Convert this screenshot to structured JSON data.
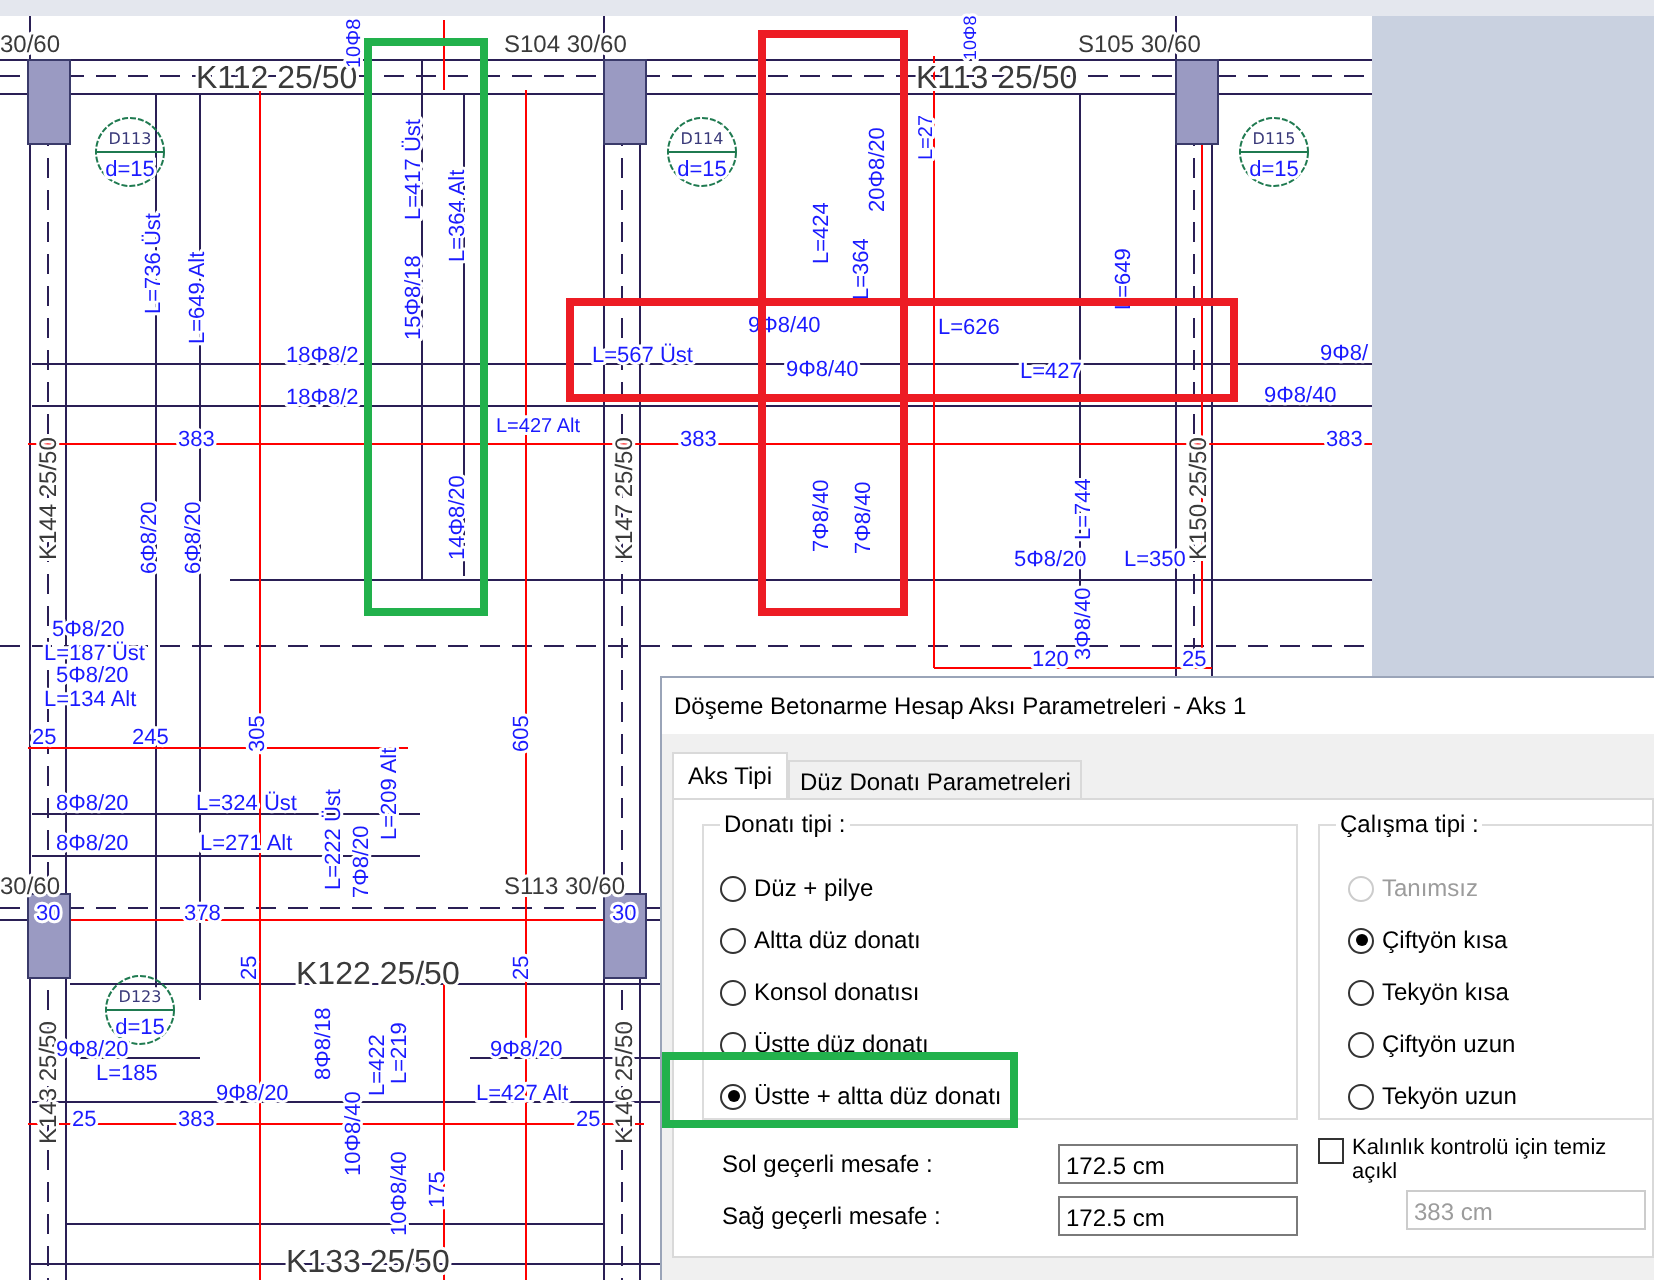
{
  "drawing": {
    "labels": [
      {
        "text": "30/60",
        "kind": "beam"
      },
      {
        "text": "S104 30/60",
        "kind": "beam"
      },
      {
        "text": "S105 30/60",
        "kind": "beam"
      },
      {
        "text": "K112 25/50",
        "kind": "beam"
      },
      {
        "text": "K113 25/50",
        "kind": "beam"
      },
      {
        "text": "L=736 Üst",
        "kind": "rebar"
      },
      {
        "text": "L=649 Alt",
        "kind": "rebar"
      },
      {
        "text": "L=417 Üst",
        "kind": "rebar"
      },
      {
        "text": "15Φ8/18",
        "kind": "rebar"
      },
      {
        "text": "L=364 Alt",
        "kind": "rebar"
      },
      {
        "text": "14Φ8/20",
        "kind": "rebar"
      },
      {
        "text": "18Φ8/2",
        "kind": "rebar"
      },
      {
        "text": "18Φ8/2",
        "kind": "rebar"
      },
      {
        "text": "L=567 Üst",
        "kind": "rebar"
      },
      {
        "text": "9Φ8/40",
        "kind": "rebar"
      },
      {
        "text": "L=427 Alt",
        "kind": "rebar"
      },
      {
        "text": "9Φ8/40",
        "kind": "rebar"
      },
      {
        "text": "L=626",
        "kind": "rebar"
      },
      {
        "text": "L=427",
        "kind": "rebar"
      },
      {
        "text": "9Φ8/",
        "kind": "rebar"
      },
      {
        "text": "9Φ8/40",
        "kind": "rebar"
      },
      {
        "text": "L=424",
        "kind": "rebar"
      },
      {
        "text": "20Φ8/20",
        "kind": "rebar"
      },
      {
        "text": "L=364",
        "kind": "rebar"
      },
      {
        "text": "383",
        "kind": "rebar"
      },
      {
        "text": "383",
        "kind": "rebar"
      },
      {
        "text": "383",
        "kind": "rebar"
      },
      {
        "text": "L=649",
        "kind": "rebar"
      },
      {
        "text": "K144 25/50",
        "kind": "beam"
      },
      {
        "text": "K147 25/50",
        "kind": "beam"
      },
      {
        "text": "K150 25/50",
        "kind": "beam"
      },
      {
        "text": "6Φ8/20",
        "kind": "rebar"
      },
      {
        "text": "6Φ8/20",
        "kind": "rebar"
      },
      {
        "text": "7Φ8/40",
        "kind": "rebar"
      },
      {
        "text": "7Φ8/40",
        "kind": "rebar"
      },
      {
        "text": "L=744",
        "kind": "rebar"
      },
      {
        "text": "5Φ8/20",
        "kind": "rebar"
      },
      {
        "text": "L=350",
        "kind": "rebar"
      },
      {
        "text": "3Φ8/40",
        "kind": "rebar"
      },
      {
        "text": "120",
        "kind": "rebar"
      },
      {
        "text": "25",
        "kind": "rebar"
      },
      {
        "text": "5Φ8/20",
        "kind": "rebar"
      },
      {
        "text": "L=187 Üst",
        "kind": "rebar"
      },
      {
        "text": "5Φ8/20",
        "kind": "rebar"
      },
      {
        "text": "L=134 Alt",
        "kind": "rebar"
      },
      {
        "text": "25",
        "kind": "rebar"
      },
      {
        "text": "245",
        "kind": "rebar"
      },
      {
        "text": "305",
        "kind": "rebar"
      },
      {
        "text": "605",
        "kind": "rebar"
      },
      {
        "text": "8Φ8/20",
        "kind": "rebar"
      },
      {
        "text": "L=324 Üst",
        "kind": "rebar"
      },
      {
        "text": "8Φ8/20",
        "kind": "rebar"
      },
      {
        "text": "L=271 Alt",
        "kind": "rebar"
      },
      {
        "text": "L=222 Üst",
        "kind": "rebar"
      },
      {
        "text": "7Φ8/20",
        "kind": "rebar"
      },
      {
        "text": "L=209 Alt",
        "kind": "rebar"
      },
      {
        "text": "30/60",
        "kind": "beam"
      },
      {
        "text": "S113 30/60",
        "kind": "beam"
      },
      {
        "text": "30",
        "kind": "rebar"
      },
      {
        "text": "378",
        "kind": "rebar"
      },
      {
        "text": "30",
        "kind": "rebar"
      },
      {
        "text": "25",
        "kind": "rebar"
      },
      {
        "text": "K122 25/50",
        "kind": "beam"
      },
      {
        "text": "25",
        "kind": "rebar"
      },
      {
        "text": "8Φ8/18",
        "kind": "rebar"
      },
      {
        "text": "L=219",
        "kind": "rebar"
      },
      {
        "text": "K143 25/50",
        "kind": "beam"
      },
      {
        "text": "K146 25/50",
        "kind": "beam"
      },
      {
        "text": "9Φ8/20",
        "kind": "rebar"
      },
      {
        "text": "L=185",
        "kind": "rebar"
      },
      {
        "text": "9Φ8/20",
        "kind": "rebar"
      },
      {
        "text": "9Φ8/20",
        "kind": "rebar"
      },
      {
        "text": "L=427 Alt",
        "kind": "rebar"
      },
      {
        "text": "25",
        "kind": "rebar"
      },
      {
        "text": "383",
        "kind": "rebar"
      },
      {
        "text": "25",
        "kind": "rebar"
      },
      {
        "text": "L=422",
        "kind": "rebar"
      },
      {
        "text": "10Φ8/40",
        "kind": "rebar"
      },
      {
        "text": "10Φ8/40",
        "kind": "rebar"
      },
      {
        "text": "175",
        "kind": "rebar"
      },
      {
        "text": "K133 25/50",
        "kind": "beam"
      },
      {
        "text": "10Φ8",
        "kind": "rebar"
      },
      {
        "text": "10Φ8",
        "kind": "rebar"
      },
      {
        "text": "L=27",
        "kind": "rebar"
      }
    ],
    "slab_tags": [
      {
        "id": "D113",
        "thickness": "d=15"
      },
      {
        "id": "D114",
        "thickness": "d=15"
      },
      {
        "id": "D115",
        "thickness": "d=15"
      },
      {
        "id": "D123",
        "thickness": "d=15"
      }
    ]
  },
  "highlights": [
    {
      "color": "#22b14c"
    },
    {
      "color": "#ed1c24"
    },
    {
      "color": "#ed1c24"
    },
    {
      "color": "#22b14c"
    }
  ],
  "dialog": {
    "title": "Döşeme Betonarme Hesap Aksı Parametreleri - Aks 1",
    "tabs": [
      {
        "label": "Aks Tipi",
        "selected": true
      },
      {
        "label": "Düz Donatı Parametreleri",
        "selected": false
      }
    ],
    "rebar_type": {
      "label": "Donatı tipi :",
      "options": [
        {
          "label": "Düz + pilye",
          "selected": false
        },
        {
          "label": "Altta düz donatı",
          "selected": false
        },
        {
          "label": "Konsol donatısı",
          "selected": false
        },
        {
          "label": "Üstte düz donatı",
          "selected": false
        },
        {
          "label": "Üstte + altta düz donatı",
          "selected": true
        }
      ]
    },
    "work_type": {
      "label": "Çalışma tipi :",
      "options": [
        {
          "label": "Tanımsız",
          "selected": false,
          "disabled": true
        },
        {
          "label": "Çiftyön kısa",
          "selected": true,
          "disabled": false
        },
        {
          "label": "Tekyön kısa",
          "selected": false,
          "disabled": false
        },
        {
          "label": "Çiftyön uzun",
          "selected": false,
          "disabled": false
        },
        {
          "label": "Tekyön uzun",
          "selected": false,
          "disabled": false
        }
      ]
    },
    "fields": [
      {
        "label": "Sol geçerli mesafe :",
        "value": "172.5 cm"
      },
      {
        "label": "Sağ geçerli mesafe :",
        "value": "172.5 cm"
      }
    ],
    "thickness_check": {
      "label": "Kalınlık kontrolü için temiz açıkl",
      "checked": false,
      "value": "383 cm",
      "disabled": true
    }
  }
}
